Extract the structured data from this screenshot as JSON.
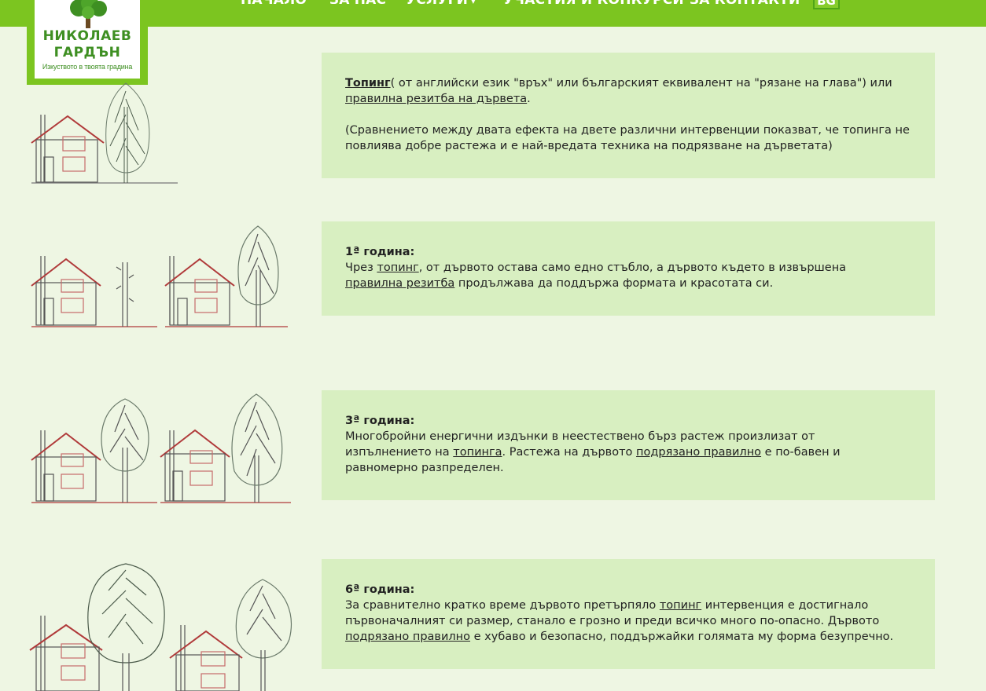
{
  "nav": {
    "home": "НАЧАЛО",
    "about": "ЗА НАС",
    "services": "УСЛУГИ",
    "contests": "УЧАСТИЯ И КОНКУРСИ",
    "contacts": "ЗА КОНТАКТИ",
    "lang": "BG",
    "services_caret_icon": "chevron-down-icon"
  },
  "logo": {
    "line1": "НИКОЛАЕВ",
    "line2": "ГАРДЪН",
    "tagline": "Изкуството в твоята градина"
  },
  "colors": {
    "nav_green": "#7cc520",
    "page_bg": "#eef6e3",
    "card_bg": "#d8efc1",
    "logo_text": "#3e8f22"
  },
  "sections": [
    {
      "lead_link": "Топинг",
      "text1": "( от английски език \"връх\" или българският еквивалент на \"рязане на глава\") или",
      "link2": "правилна резитба на дървета",
      "text2": ".",
      "note": "(Сравнението между двата ефекта на двете различни интервенции показват, че топинга не повлиява добре растежа и е най-вредата техника на подрязване на дърветата)"
    },
    {
      "heading": "1ª година:",
      "t1": "Чрез ",
      "link1": "топинг",
      "t2": ", от дървото остава само едно стъбло, а дървото където в извършена",
      "link2": "правилна резитба",
      "t3": " продължава да поддържа формата и красотата си."
    },
    {
      "heading": "3ª година:",
      "t1": "Многобройни енергични издънки в неестествено бърз растеж произлизат от изпълнението на ",
      "link1": "топинга",
      "t2": ". Растежа на дървото ",
      "link2": "подрязано правилно",
      "t3": " е по-бавен и равномерно разпределен."
    },
    {
      "heading": "6ª година:",
      "t1": "За сравнително кратко време дървото претърпяло ",
      "link1": "топинг",
      "t2": " интервенция е достигнало първоначалният си размер, станало е грозно и преди всичко много по-опасно. Дървото",
      "link2": "подрязано правилно",
      "t3": " е хубаво и безопасно, поддържайки голямата му форма безупречно."
    }
  ]
}
